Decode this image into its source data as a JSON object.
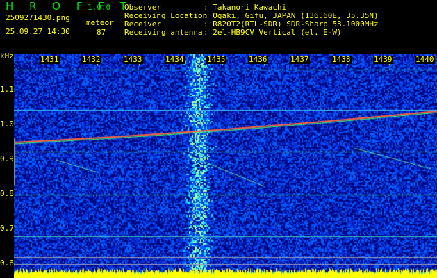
{
  "app": {
    "title": "H R O F F T",
    "version": "1.0.0"
  },
  "file": {
    "name": "2509271430.png",
    "datetime": "25.09.27 14:30"
  },
  "meteor": {
    "label": "meteor",
    "count": "87"
  },
  "info": {
    "observer_label": "Observer",
    "observer": ": Takanori Kawachi",
    "location_label": "Receiving Location",
    "location": ": Ogaki, Gifu, JAPAN (136.60E, 35.35N)",
    "receiver_label": "Receiver",
    "receiver": ": R820T2(RTL-SDR) SDR-Sharp 53.1000MHz",
    "antenna_label": "Receiving antenna",
    "antenna": ": 2el-HB9CV Vertical (el. E-W)"
  },
  "axis": {
    "y_unit": "kHz",
    "x_ticks": [
      "1431",
      "1432",
      "1433",
      "1434",
      "1435",
      "1436",
      "1437",
      "1438",
      "1439",
      "1440"
    ],
    "y_ticks": [
      "1.1",
      "1.0",
      "0.9",
      "0.8",
      "0.7",
      "0.6"
    ]
  },
  "colors": {
    "text": "#ffff00",
    "title": "#00e000",
    "background": "#000000"
  }
}
